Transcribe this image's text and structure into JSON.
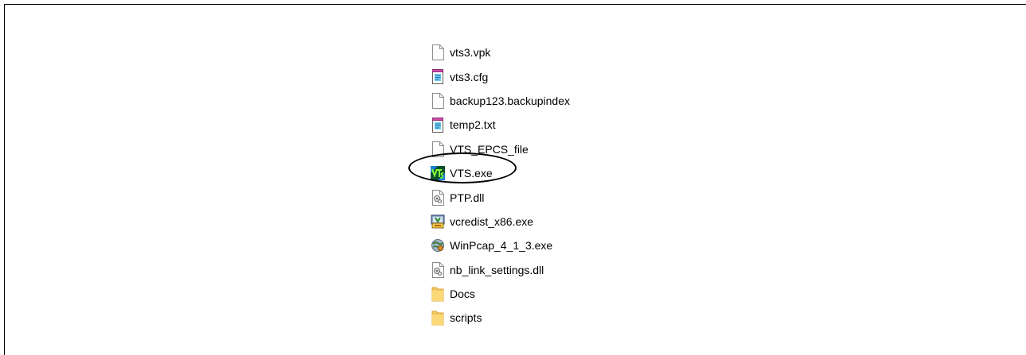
{
  "files": [
    {
      "name": "vts3.vpk",
      "icon": "blank-file-icon"
    },
    {
      "name": "vts3.cfg",
      "icon": "notepad-file-icon"
    },
    {
      "name": "backup123.backupindex",
      "icon": "blank-file-icon"
    },
    {
      "name": "temp2.txt",
      "icon": "notepad-file-icon"
    },
    {
      "name": "VTS_EPCS_file",
      "icon": "blank-file-icon"
    },
    {
      "name": "VTS.exe",
      "icon": "vts-app-icon"
    },
    {
      "name": "PTP.dll",
      "icon": "dll-file-icon"
    },
    {
      "name": "vcredist_x86.exe",
      "icon": "installer-icon"
    },
    {
      "name": "WinPcap_4_1_3.exe",
      "icon": "winpcap-icon"
    },
    {
      "name": "nb_link_settings.dll",
      "icon": "dll-file-icon"
    },
    {
      "name": "Docs",
      "icon": "folder-icon"
    },
    {
      "name": "scripts",
      "icon": "folder-icon"
    }
  ],
  "highlighted_file": "VTS.exe"
}
